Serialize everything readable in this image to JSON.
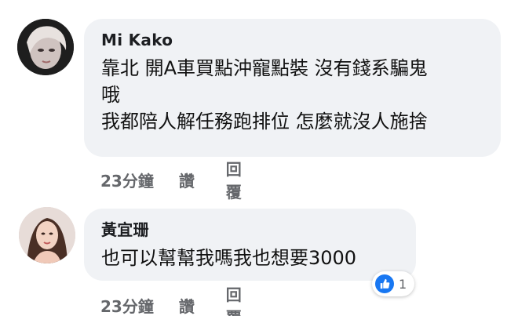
{
  "comments": [
    {
      "author": "Mi Kako",
      "lines": [
        "靠北 開A車買點沖寵點裝 沒有錢系騙鬼",
        "哦",
        "我都陪人解任務跑排位 怎麼就沒人施捨"
      ],
      "time": "23分鐘",
      "like_label": "讚",
      "reply_label": "回覆",
      "avatar_icon": "avatar-photo"
    },
    {
      "author": "黃宜珊",
      "lines": [
        "也可以幫幫我嗎我也想要3000"
      ],
      "time": "23分鐘",
      "like_label": "讚",
      "reply_label": "回覆",
      "avatar_icon": "avatar-photo",
      "reaction_count": "1",
      "reaction_icon": "like-thumb-icon"
    }
  ],
  "colors": {
    "bubble": "#f0f2f5",
    "meta_text": "#65676b",
    "reaction_blue": "#1877f2"
  }
}
